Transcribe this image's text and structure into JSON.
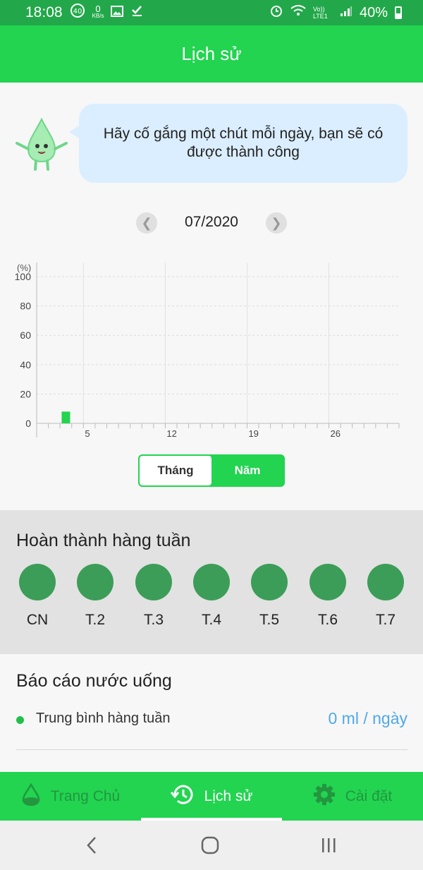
{
  "status_bar": {
    "time": "18:08",
    "net_speed_value": "0",
    "net_speed_unit": "KB/s",
    "volte_label": "Vo)) LTE1",
    "battery": "40%"
  },
  "header": {
    "title": "Lịch sử"
  },
  "motivation": {
    "text": "Hãy cố gắng một chút mỗi ngày, bạn sẽ có được thành công"
  },
  "month_nav": {
    "label": "07/2020"
  },
  "chart_data": {
    "type": "bar",
    "y_unit_label": "(%)",
    "ylim": [
      0,
      100
    ],
    "y_ticks": [
      "0",
      "20",
      "40",
      "60",
      "80",
      "100"
    ],
    "x_tick_labels": [
      "5",
      "12",
      "19",
      "26"
    ],
    "days": 31,
    "values": [
      {
        "day": 3,
        "value": 8
      }
    ],
    "bar_color": "#22d450",
    "grid": true
  },
  "toggle": {
    "month_label": "Tháng",
    "year_label": "Năm",
    "selected": "Năm"
  },
  "weekly": {
    "title": "Hoàn thành hàng tuần",
    "days": [
      "CN",
      "T.2",
      "T.3",
      "T.4",
      "T.5",
      "T.6",
      "T.7"
    ]
  },
  "report": {
    "title": "Báo cáo nước uống",
    "rows": [
      {
        "label": "Trung bình hàng tuần",
        "value": "0 ml / ngày"
      }
    ]
  },
  "bottom_nav": {
    "home": "Trang Chủ",
    "history": "Lịch sử",
    "settings": "Cài đặt"
  },
  "colors": {
    "primary": "#22d450",
    "dark_green": "#3c9d58",
    "accent_blue": "#4fa9e6"
  }
}
